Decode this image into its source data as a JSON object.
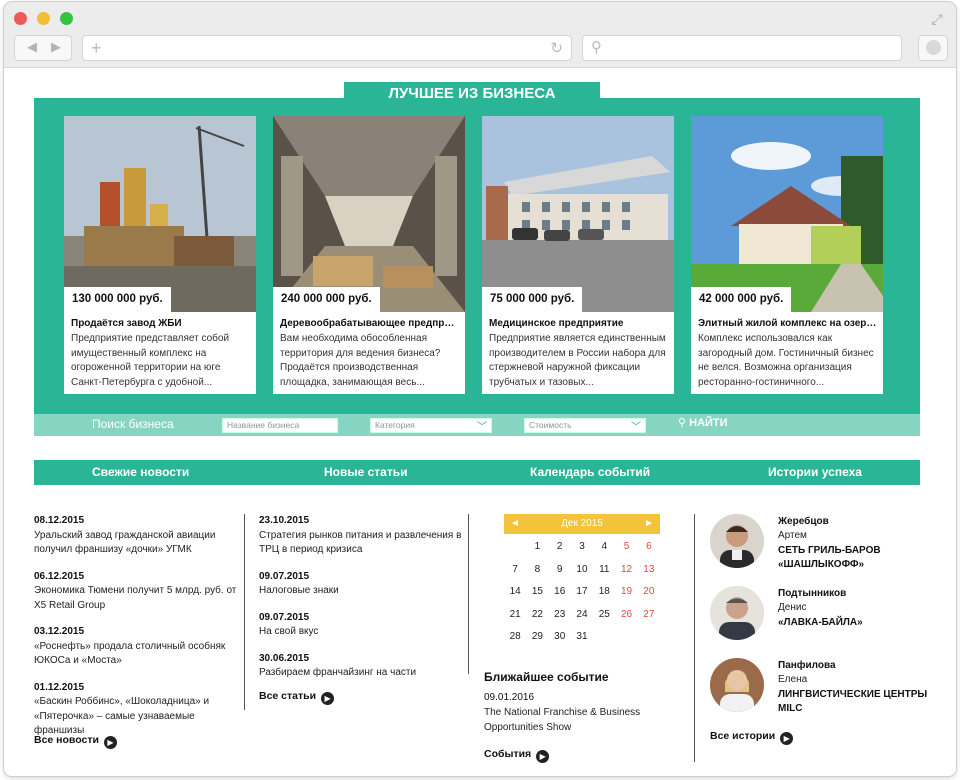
{
  "section_title": "ЛУЧШЕЕ ИЗ БИЗНЕСА",
  "cards": [
    {
      "price": "130 000 000 руб.",
      "title": "Продаётся завод ЖБИ",
      "desc": "Предприятие представляет собой имущественный комплекс на огороженной территории на юге Санкт-Петербурга с удобной..."
    },
    {
      "price": "240 000 000 руб.",
      "title": "Деревообрабатывающее предприятие ...",
      "desc": "Вам необходима обособленная территория для ведения бизнеса? Продаётся производственная площадка, занимающая весь..."
    },
    {
      "price": "75 000 000 руб.",
      "title": "Медицинское предприятие",
      "desc": "Предприятие является единственным производителем в России набора для стержневой наружной фиксации трубчатых и тазовых..."
    },
    {
      "price": "42 000 000 руб.",
      "title": "Элитный жилой комплекс на озере Отра...",
      "desc": "Комплекс использовался как загородный дом. Гостиничный бизнес не велся. Возможна организация ресторанно-гостиничного..."
    }
  ],
  "search": {
    "label": "Поиск бизнеса",
    "name_placeholder": "Название бизнеса",
    "category": "Категория",
    "cost": "Стоимость",
    "button": "НАЙТИ"
  },
  "tabs": [
    "Свежие новости",
    "Новые статьи",
    "Календарь событий",
    "Истории успеха"
  ],
  "news": [
    {
      "date": "08.12.2015",
      "text": "Уральский завод гражданской авиации получил франшизу «дочки» УГМК"
    },
    {
      "date": "06.12.2015",
      "text": "Экономика Тюмени получит 5 млрд. руб. от X5 Retail Group"
    },
    {
      "date": "03.12.2015",
      "text": "«Роснефть» продала столичный особняк ЮКОСа и «Моста»"
    },
    {
      "date": "01.12.2015",
      "text": "«Баскин Роббинс», «Шоколадница» и «Пятерочка» – самые узнаваемые франшизы"
    }
  ],
  "news_more": "Все новости",
  "articles": [
    {
      "date": "23.10.2015",
      "text": "Стратегия рынков питания и развлечения в ТРЦ в период кризиса"
    },
    {
      "date": "09.07.2015",
      "text": "Налоговые знаки"
    },
    {
      "date": "09.07.2015",
      "text": "На свой вкус"
    },
    {
      "date": "30.06.2015",
      "text": "Разбираем франчайзинг на части"
    }
  ],
  "articles_more": "Все статьи",
  "calendar": {
    "month": "Дек 2015",
    "prev": "◄",
    "next": "►",
    "weeks": [
      [
        "",
        "1",
        "2",
        "3",
        "4",
        "5",
        "6"
      ],
      [
        "7",
        "8",
        "9",
        "10",
        "11",
        "12",
        "13"
      ],
      [
        "14",
        "15",
        "16",
        "17",
        "18",
        "19",
        "20"
      ],
      [
        "21",
        "22",
        "23",
        "24",
        "25",
        "26",
        "27"
      ],
      [
        "28",
        "29",
        "30",
        "31",
        "",
        "",
        ""
      ]
    ]
  },
  "nearest_event": {
    "title": "Ближайшее событие",
    "date": "09.01.2016",
    "name": "The National Franchise & Business Opportunities Show"
  },
  "events_more": "События",
  "stories": [
    {
      "surname": "Жеребцов",
      "name": "Артем",
      "company": "СЕТЬ ГРИЛЬ-БАРОВ «ШАШЛЫКОФФ»"
    },
    {
      "surname": "Подтынников",
      "name": "Денис",
      "company": "«ЛАВКА-БАЙЛА»"
    },
    {
      "surname": "Панфилова",
      "name": "Елена",
      "company": "ЛИНГВИСТИЧЕСКИЕ ЦЕНТРЫ MILC"
    }
  ],
  "stories_more": "Все истории",
  "colors": {
    "accent": "#2bb597",
    "accent_light": "#86d5c3",
    "calendar_header": "#f3c33b",
    "weekend": "#e04a3a"
  }
}
